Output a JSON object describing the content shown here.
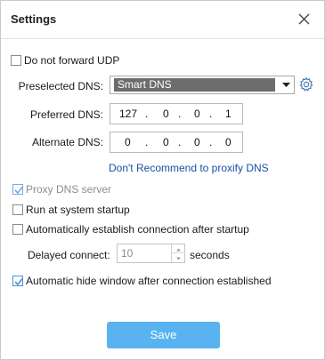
{
  "window": {
    "title": "Settings"
  },
  "options": {
    "do_not_forward_udp": {
      "label": "Do not forward UDP",
      "checked": false
    },
    "proxy_dns_server": {
      "label": "Proxy DNS server",
      "checked": true,
      "disabled": true
    },
    "run_at_startup": {
      "label": "Run at system startup",
      "checked": false
    },
    "auto_connect": {
      "label": "Automatically establish connection after startup",
      "checked": false
    },
    "auto_hide": {
      "label": "Automatic hide window after connection established",
      "checked": true
    }
  },
  "dns": {
    "preselected_label": "Preselected DNS:",
    "preselected_value": "Smart DNS",
    "preferred_label": "Preferred DNS:",
    "preferred_octets": [
      "127",
      "0",
      "0",
      "1"
    ],
    "alternate_label": "Alternate DNS:",
    "alternate_octets": [
      "0",
      "0",
      "0",
      "0"
    ],
    "separator": ".",
    "recommend_link": "Don't Recommend to proxify DNS"
  },
  "delay": {
    "label": "Delayed connect:",
    "value": "10",
    "unit": "seconds"
  },
  "footer": {
    "save_label": "Save"
  },
  "colors": {
    "accent": "#59b3f1",
    "link": "#1a4fa8",
    "check": "#4a90d9",
    "select_highlight": "#6d6d6d"
  },
  "icons": {
    "close": "close-icon",
    "gear": "gear-icon",
    "dropdown": "chevron-down-icon",
    "check": "checkmark-icon"
  }
}
